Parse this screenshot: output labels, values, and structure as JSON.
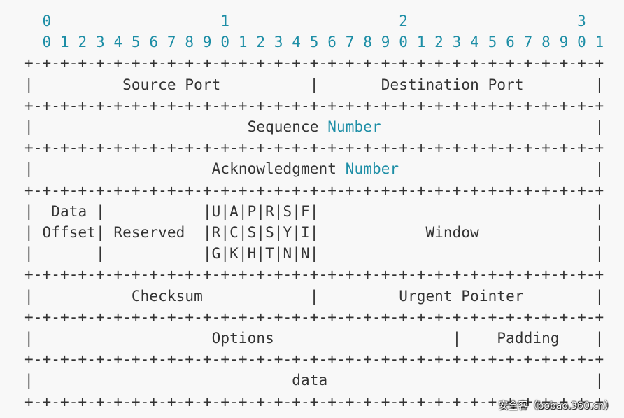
{
  "ruler": {
    "tens": "  0                   1                   2                   3",
    "ones": "  0 1 2 3 4 5 6 7 8 9 0 1 2 3 4 5 6 7 8 9 0 1 2 3 4 5 6 7 8 9 0 1"
  },
  "separator": "+-+-+-+-+-+-+-+-+-+-+-+-+-+-+-+-+-+-+-+-+-+-+-+-+-+-+-+-+-+-+-+-+",
  "rows": {
    "ports": "|          Source Port          |       Destination Port        |",
    "seq_pre": "|                        Sequence ",
    "seq_kw": "Number",
    "seq_post": "                        |",
    "ack_pre": "|                    Acknowledgment ",
    "ack_kw": "Number",
    "ack_post": "                      |",
    "flags1": "|  Data |           |U|A|P|R|S|F|                               |",
    "flags2": "| Offset| Reserved  |R|C|S|S|Y|I|            Window             |",
    "flags3": "|       |           |G|K|H|T|N|N|                               |",
    "checksum": "|           Checksum            |         Urgent Pointer        |",
    "options": "|                    Options                    |    Padding    |",
    "data": "|                             data                              |"
  },
  "watermark": "安全客（bobao.360.cn）",
  "colors": {
    "text": "#333333",
    "ruler": "#1d8ea6",
    "background": "#f8f8f8"
  }
}
